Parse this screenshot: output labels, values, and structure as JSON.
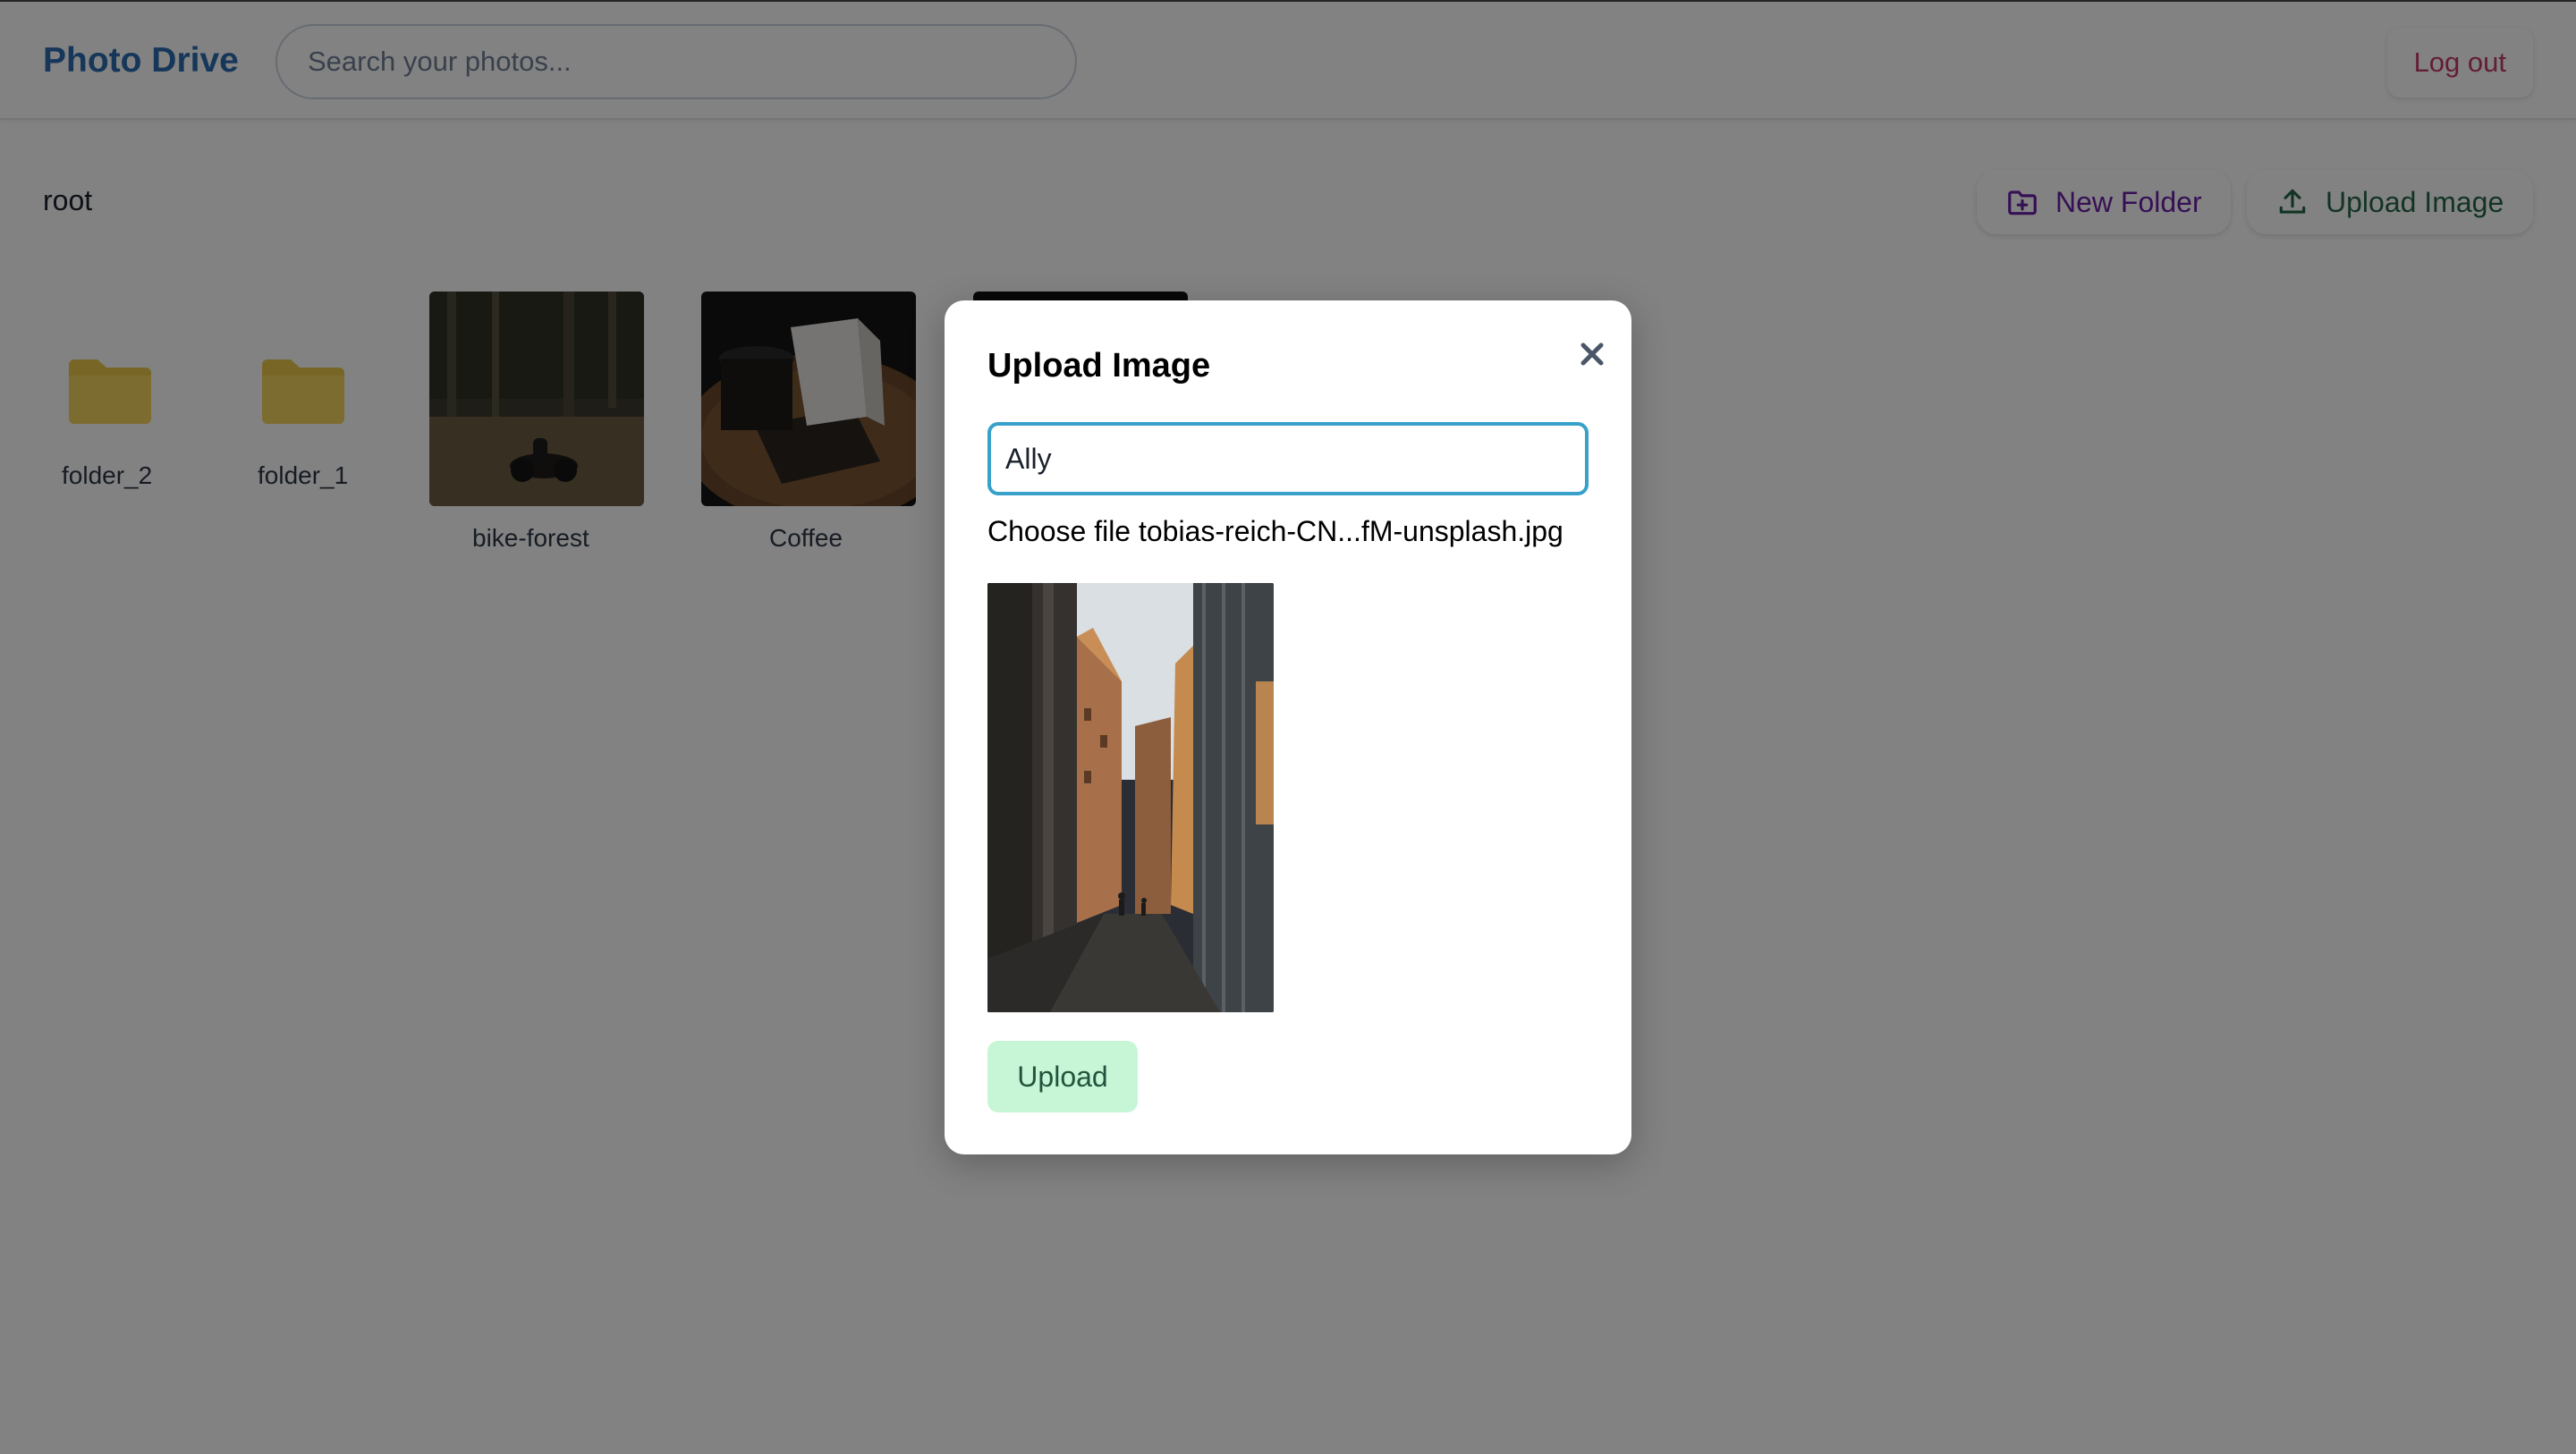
{
  "header": {
    "brand": "Photo Drive",
    "search_placeholder": "Search your photos...",
    "logout_label": "Log out"
  },
  "toolbar": {
    "breadcrumb": "root",
    "new_folder_label": "New Folder",
    "upload_image_label": "Upload Image"
  },
  "grid": {
    "folders": [
      {
        "name": "folder_2"
      },
      {
        "name": "folder_1"
      }
    ],
    "images": [
      {
        "name": "bike-forest"
      },
      {
        "name": "Coffee"
      }
    ]
  },
  "modal": {
    "title": "Upload Image",
    "name_value": "Ally",
    "choose_file_label": "Choose file",
    "file_name": "tobias-reich-CN...fM-unsplash.jpg",
    "upload_label": "Upload"
  },
  "colors": {
    "brand": "#2b6cb0",
    "logout": "#c53a6a",
    "new_folder": "#6b21a8",
    "upload_image": "#276749",
    "folder": "#ecc94b",
    "upload_button_bg": "#c6f6d5",
    "input_focus": "#38a1c9"
  },
  "icons": {
    "new_folder": "folder-plus-icon",
    "upload": "upload-icon",
    "close": "close-icon",
    "folder": "folder-icon"
  }
}
